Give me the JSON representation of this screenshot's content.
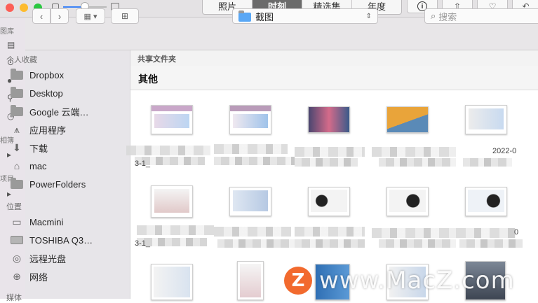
{
  "photos": {
    "tabs": [
      "照片",
      "时刻",
      "精选集",
      "年度"
    ],
    "active_tab": "时刻",
    "sidebar_labels": [
      "图库",
      "相簿",
      "项目"
    ]
  },
  "finder": {
    "path_title": "截图",
    "search_placeholder": "搜索",
    "sidebar": {
      "favorites_title": "个人收藏",
      "favorites": [
        "Dropbox",
        "Desktop",
        "Google 云端…",
        "应用程序",
        "下载",
        "mac",
        "PowerFolders"
      ],
      "locations_title": "位置",
      "locations": [
        "Macmini",
        "TOSHIBA Q3…",
        "远程光盘",
        "网络"
      ],
      "media_title": "媒体"
    },
    "shared_header": "共享文件夹",
    "group_title": "其他",
    "filename_fragments": {
      "row1_right": "2022-0",
      "row1_left": "3-1_",
      "row2_right": "0",
      "row2_left": "3-1_"
    }
  },
  "watermark": {
    "badge": "Z",
    "text": "www.MacZ.com",
    "color": "#f26a2e"
  }
}
